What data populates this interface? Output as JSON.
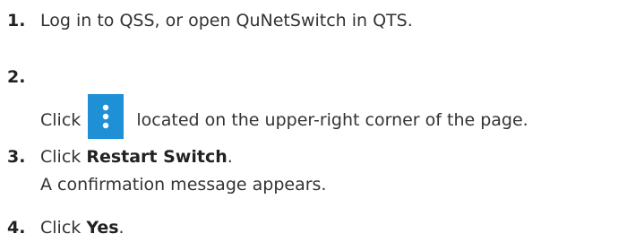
{
  "steps": [
    {
      "number": "1.",
      "text": "Log in to QSS, or open QuNetSwitch in QTS."
    },
    {
      "number": "2.",
      "text_before": "Click",
      "icon": "more-vertical-icon",
      "text_after": "located on the upper-right corner of the page."
    },
    {
      "number": "3.",
      "text_before": "Click",
      "bold": "Restart Switch",
      "text_after": ".",
      "result": "A confirmation message appears."
    },
    {
      "number": "4.",
      "text_before": "Click",
      "bold": "Yes",
      "text_after": "."
    }
  ],
  "colors": {
    "icon_background": "#1f8fd6",
    "icon_foreground": "#ffffff",
    "text": "#333333"
  }
}
